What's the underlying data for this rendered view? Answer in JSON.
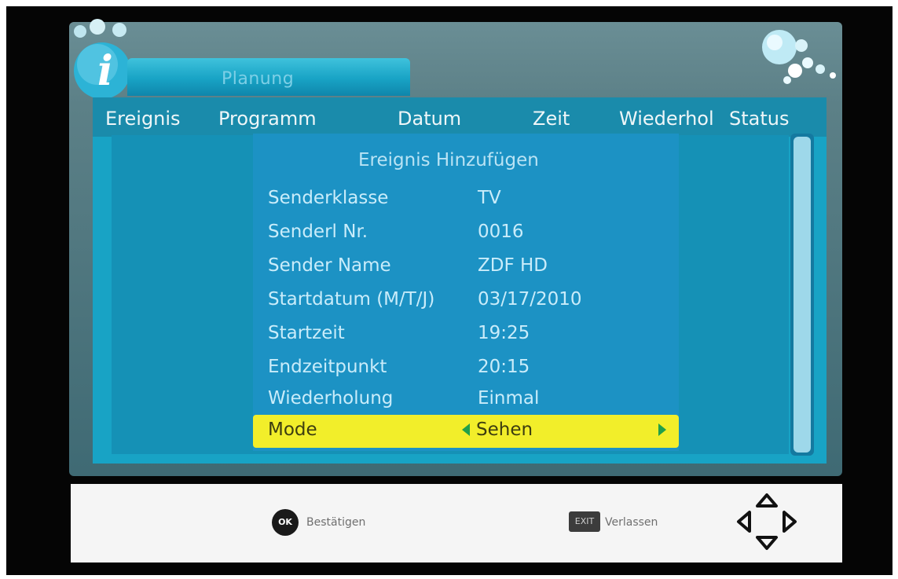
{
  "tab_title": "Planung",
  "columns": [
    "Ereignis",
    "Programm",
    "Datum",
    "Zeit",
    "Wiederhol",
    "Status"
  ],
  "dialog": {
    "title": "Ereignis Hinzufügen",
    "rows": [
      {
        "label": "Senderklasse",
        "value": "TV"
      },
      {
        "label": "Senderl Nr.",
        "value": "0016"
      },
      {
        "label": "Sender Name",
        "value": "ZDF HD"
      },
      {
        "label": "Startdatum (M/T/J)",
        "value": "03/17/2010"
      },
      {
        "label": "Startzeit",
        "value": "19:25"
      },
      {
        "label": "Endzeitpunkt",
        "value": "20:15"
      },
      {
        "label": "Wiederholung",
        "value": "Einmal"
      }
    ],
    "selected_row": {
      "label": "Mode",
      "value": "Sehen"
    }
  },
  "footer": {
    "ok_key": "OK",
    "ok_label": "Bestätigen",
    "exit_key": "EXIT",
    "exit_label": "Verlassen"
  },
  "icons": {
    "ok": "ok-button-icon",
    "exit": "exit-button-icon",
    "nav": "direction-pad-icon",
    "info": "info-icon"
  },
  "colors": {
    "highlight": "#f2ee2a",
    "dialog_bg": "#1c92c4",
    "arrow": "#21a04a"
  }
}
